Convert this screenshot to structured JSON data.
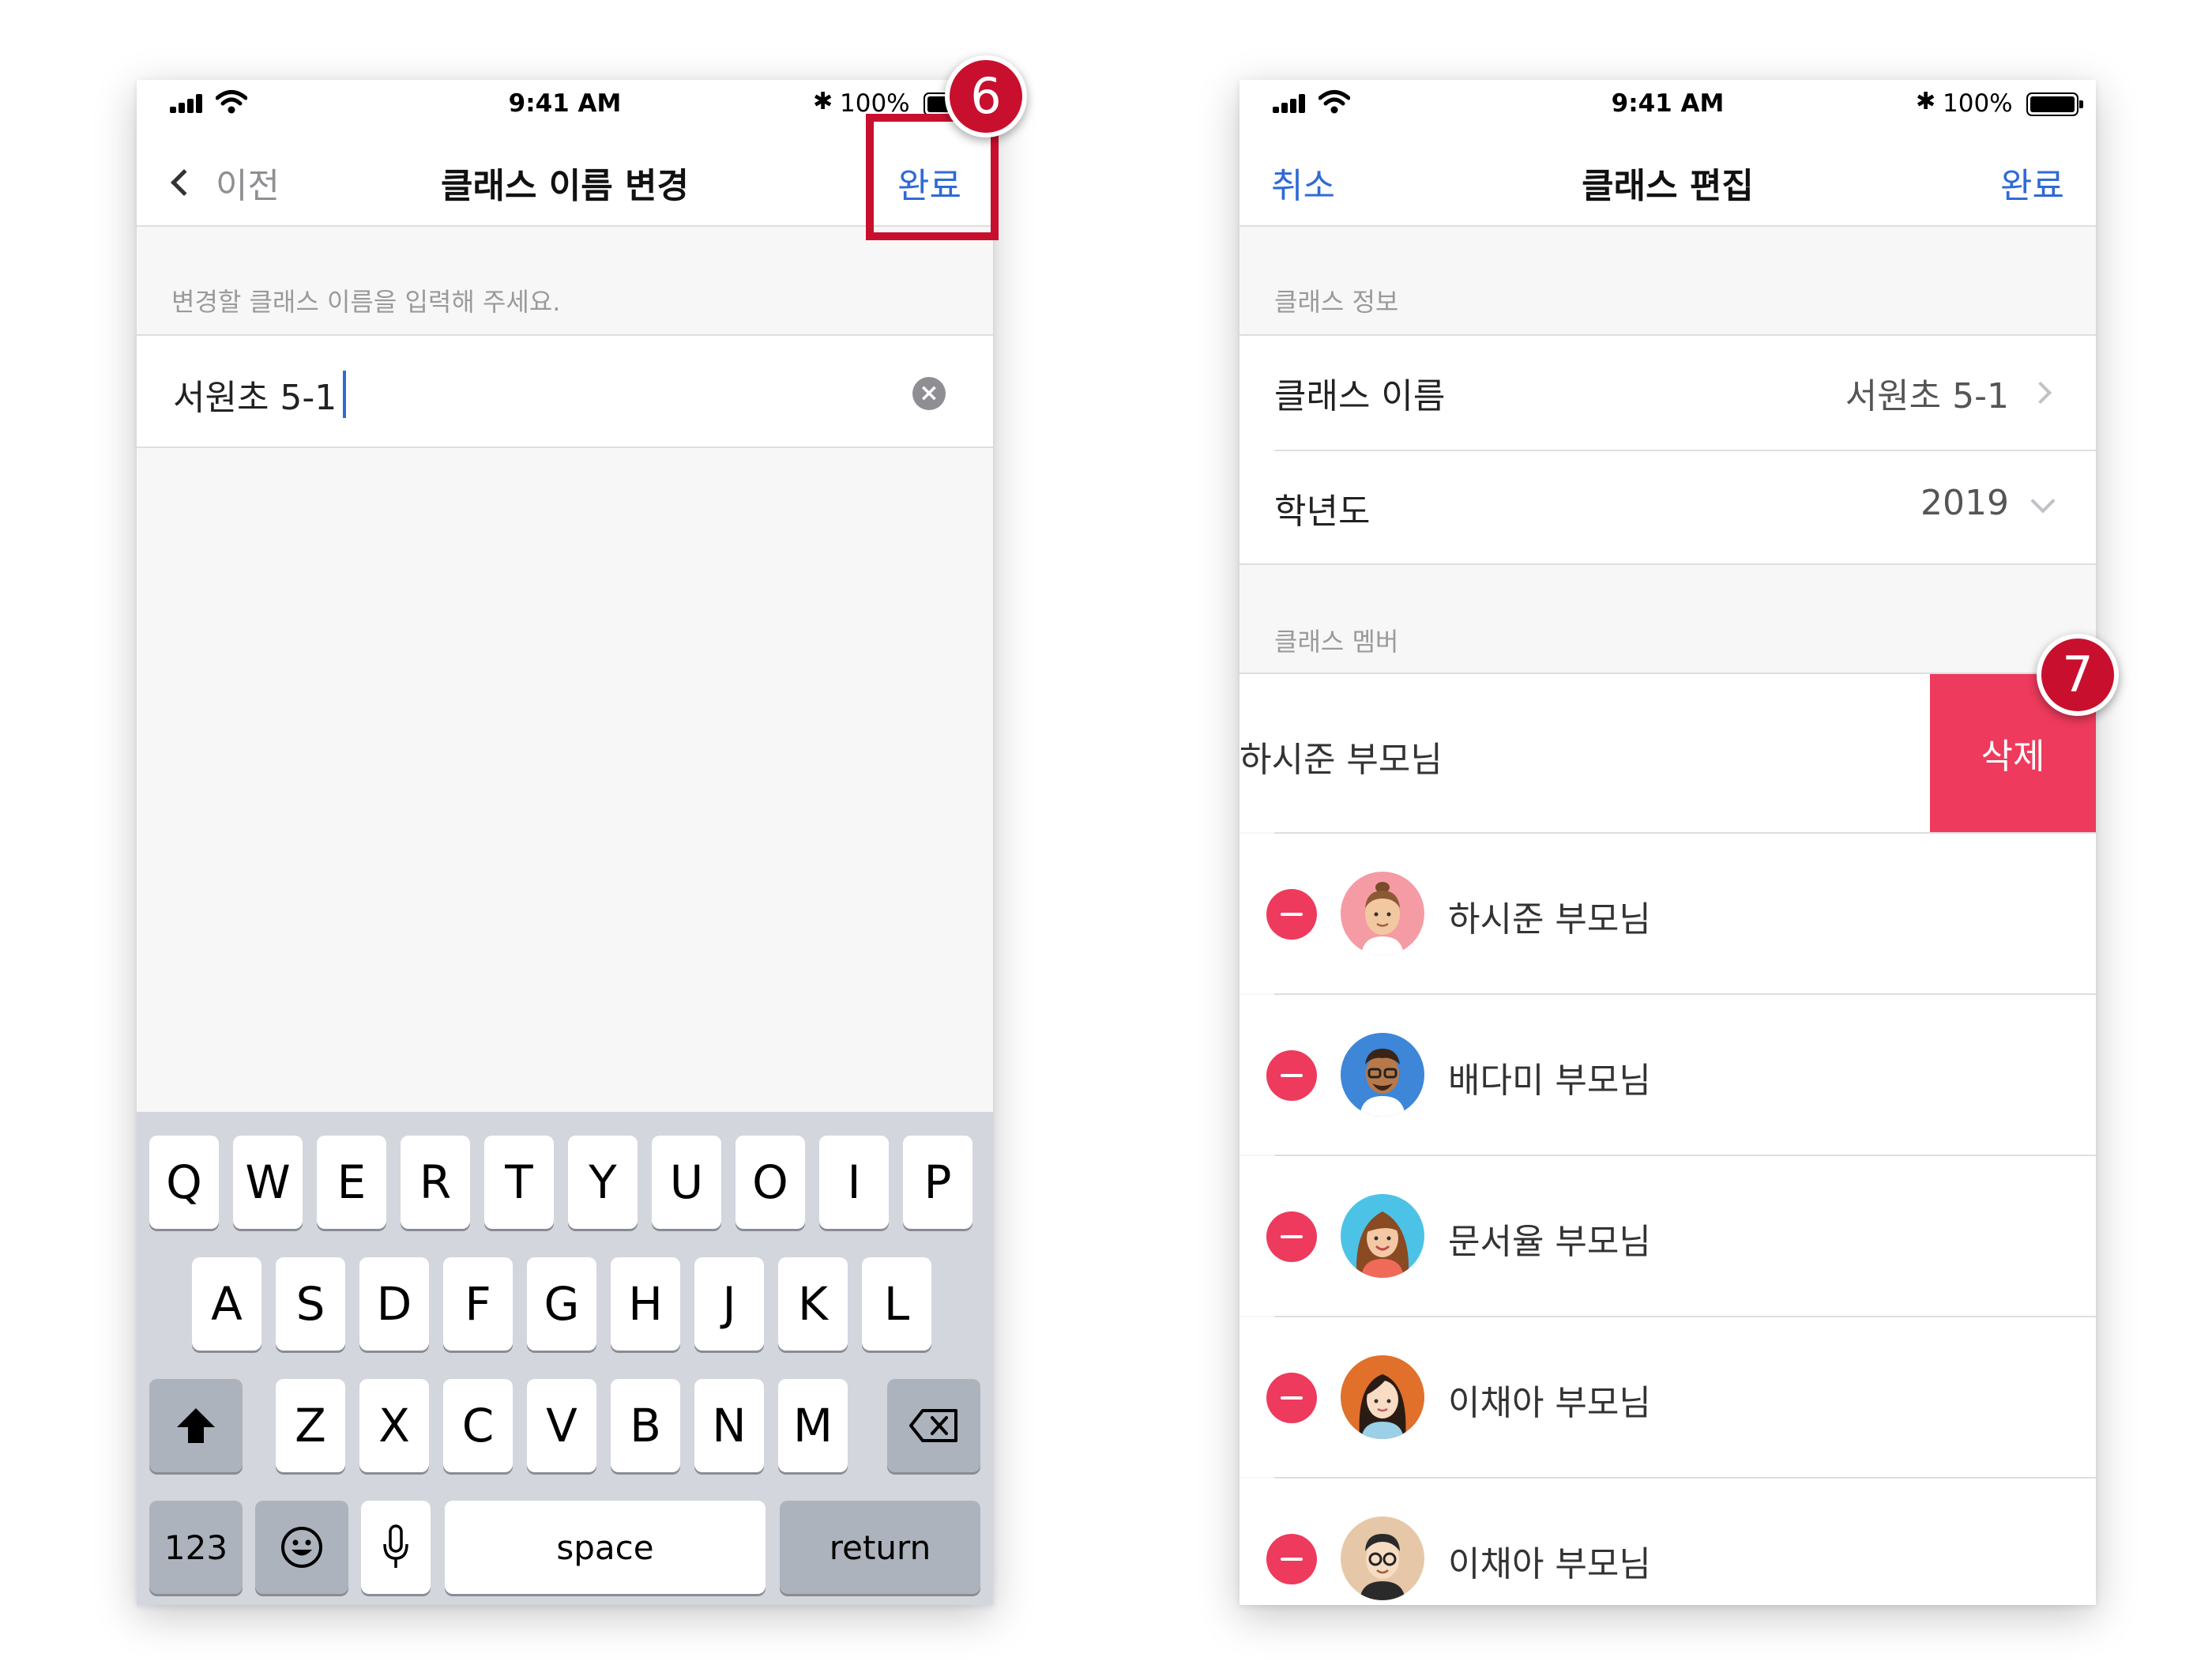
{
  "status": {
    "time": "9:41 AM",
    "battery": "100%",
    "bluetooth": "✱"
  },
  "left": {
    "nav": {
      "back_label": "이전",
      "title": "클래스 이름 변경",
      "done_label": "완료"
    },
    "hint": "변경할 클래스 이름을 입력해 주세요.",
    "input_value": "서원초 5-1",
    "keyboard": {
      "row1": [
        "Q",
        "W",
        "E",
        "R",
        "T",
        "Y",
        "U",
        "O",
        "I",
        "P"
      ],
      "row2": [
        "A",
        "S",
        "D",
        "F",
        "G",
        "H",
        "J",
        "K",
        "L"
      ],
      "row3": [
        "Z",
        "X",
        "C",
        "V",
        "B",
        "N",
        "M"
      ],
      "numbers_label": "123",
      "space_label": "space",
      "return_label": "return"
    },
    "badge": "6"
  },
  "right": {
    "nav": {
      "cancel_label": "취소",
      "title": "클래스 편집",
      "done_label": "완료"
    },
    "info_header": "클래스 정보",
    "class_name_label": "클래스 이름",
    "class_name_value": "서원초 5-1",
    "year_label": "학년도",
    "year_value": "2019",
    "members_header": "클래스 멤버",
    "swiped_member": "하시준 부모님",
    "delete_label": "삭제",
    "members": [
      {
        "name": "하시준 부모님"
      },
      {
        "name": "배다미 부모님"
      },
      {
        "name": "문서율 부모님"
      },
      {
        "name": "이채아 부모님"
      },
      {
        "name": "이채아 부모님"
      }
    ],
    "badge": "7"
  },
  "colors": {
    "accent": "#2f6ad6",
    "delete": "#ee3a5c",
    "annotation": "#c8102e"
  }
}
